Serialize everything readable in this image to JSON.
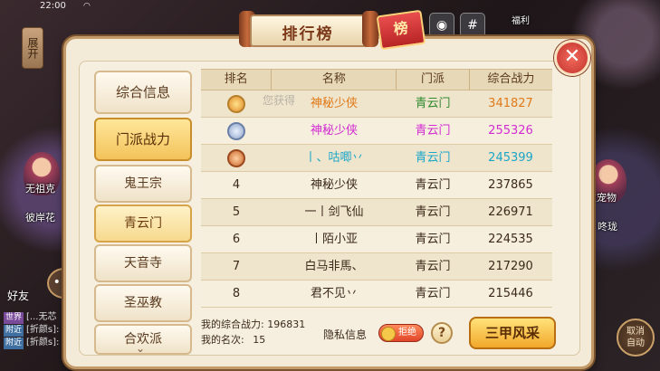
{
  "status_bar": {
    "time": "22:00",
    "wifi_icon": "wifi-icon"
  },
  "side": {
    "expand_label": "展开"
  },
  "scene": {
    "npc_left_name": "无祖克",
    "npc_left_sub": "彼岸花",
    "npc_left_name2": "显",
    "npc_right_name": "被宠物",
    "npc_right_sub": "咚珑",
    "top_hint": "福利"
  },
  "social": {
    "friends_label": "好友"
  },
  "chat": {
    "lines": [
      {
        "tag": "世界",
        "text": "[...无芯"
      },
      {
        "tag": "附近",
        "text": "[折颜s]: 上"
      },
      {
        "tag": "附近",
        "text": "[折颜s]: 上"
      }
    ]
  },
  "auto_button": {
    "line1": "取消",
    "line2": "自动"
  },
  "panel": {
    "title": "排行榜",
    "badge": "榜",
    "tabs": [
      {
        "label": "综合信息"
      },
      {
        "label": "门派战力"
      },
      {
        "label": "鬼王宗"
      },
      {
        "label": "青云门"
      },
      {
        "label": "天音寺"
      },
      {
        "label": "圣巫教"
      },
      {
        "label": "合欢派"
      }
    ],
    "tabs_more": "⌄",
    "table": {
      "headers": {
        "rank": "排名",
        "name": "名称",
        "faction": "门派",
        "power": "综合战力"
      },
      "rows": [
        {
          "rank": "",
          "medal": "gold",
          "name": "神秘少侠",
          "faction": "青云门",
          "power": "341827"
        },
        {
          "rank": "",
          "medal": "silver",
          "name": "神秘少侠",
          "faction": "青云门",
          "power": "255326"
        },
        {
          "rank": "",
          "medal": "bronze",
          "name": "丨、咕唧丷",
          "faction": "青云门",
          "power": "245399"
        },
        {
          "rank": "4",
          "name": "神秘少侠",
          "faction": "青云门",
          "power": "237865"
        },
        {
          "rank": "5",
          "name": "一丨剑飞仙",
          "faction": "青云门",
          "power": "226971"
        },
        {
          "rank": "6",
          "name": "丨陌小亚",
          "faction": "青云门",
          "power": "224535"
        },
        {
          "rank": "7",
          "name": "白马非馬、",
          "faction": "青云门",
          "power": "217290"
        },
        {
          "rank": "8",
          "name": "君不见丷",
          "faction": "青云门",
          "power": "215446"
        }
      ]
    },
    "overlay_text": "您获得",
    "footer": {
      "my_power_label": "我的综合战力:",
      "my_power_value": "196831",
      "my_rank_label": "我的名次:",
      "my_rank_value": "15",
      "privacy_label": "隐私信息",
      "toggle_label": "拒绝",
      "help": "?",
      "cta_label": "三甲风采"
    }
  },
  "colors": {
    "rank1_power": "#e07a18",
    "rank2_name": "#d12cd1",
    "rank3_name": "#1aa6c9",
    "faction_green": "#2e8a2e"
  }
}
